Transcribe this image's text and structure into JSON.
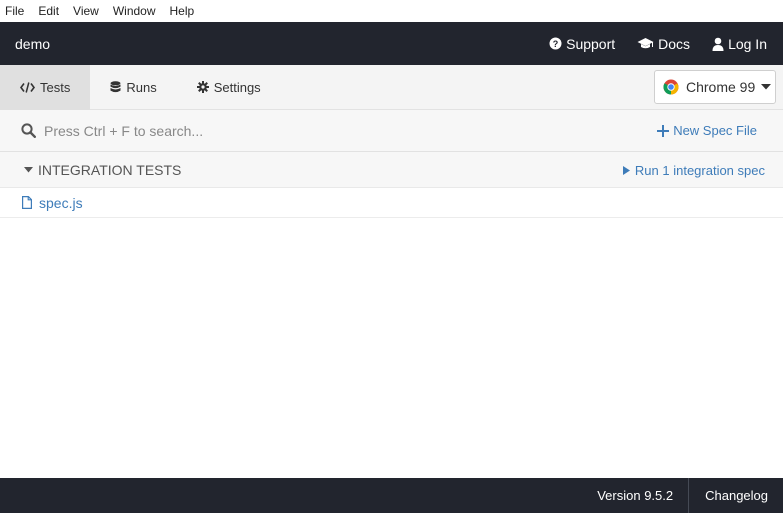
{
  "menu": [
    "File",
    "Edit",
    "View",
    "Window",
    "Help"
  ],
  "header": {
    "project_name": "demo",
    "support_label": "Support",
    "docs_label": "Docs",
    "login_label": "Log In"
  },
  "tabs": {
    "tests_label": "Tests",
    "runs_label": "Runs",
    "settings_label": "Settings",
    "active": "Tests"
  },
  "browser": {
    "selected": "Chrome 99",
    "icon": "chrome-icon"
  },
  "search": {
    "placeholder": "Press Ctrl + F to search...",
    "value": "",
    "new_spec_label": "New Spec File"
  },
  "specs": {
    "section_title": "INTEGRATION TESTS",
    "run_label": "Run 1 integration spec",
    "files": [
      "spec.js"
    ]
  },
  "footer": {
    "version": "Version 9.5.2",
    "changelog_label": "Changelog"
  },
  "colors": {
    "dark_bar": "#22252e",
    "link_blue": "#3e7cb9",
    "tab_active": "#e0e0e0"
  }
}
